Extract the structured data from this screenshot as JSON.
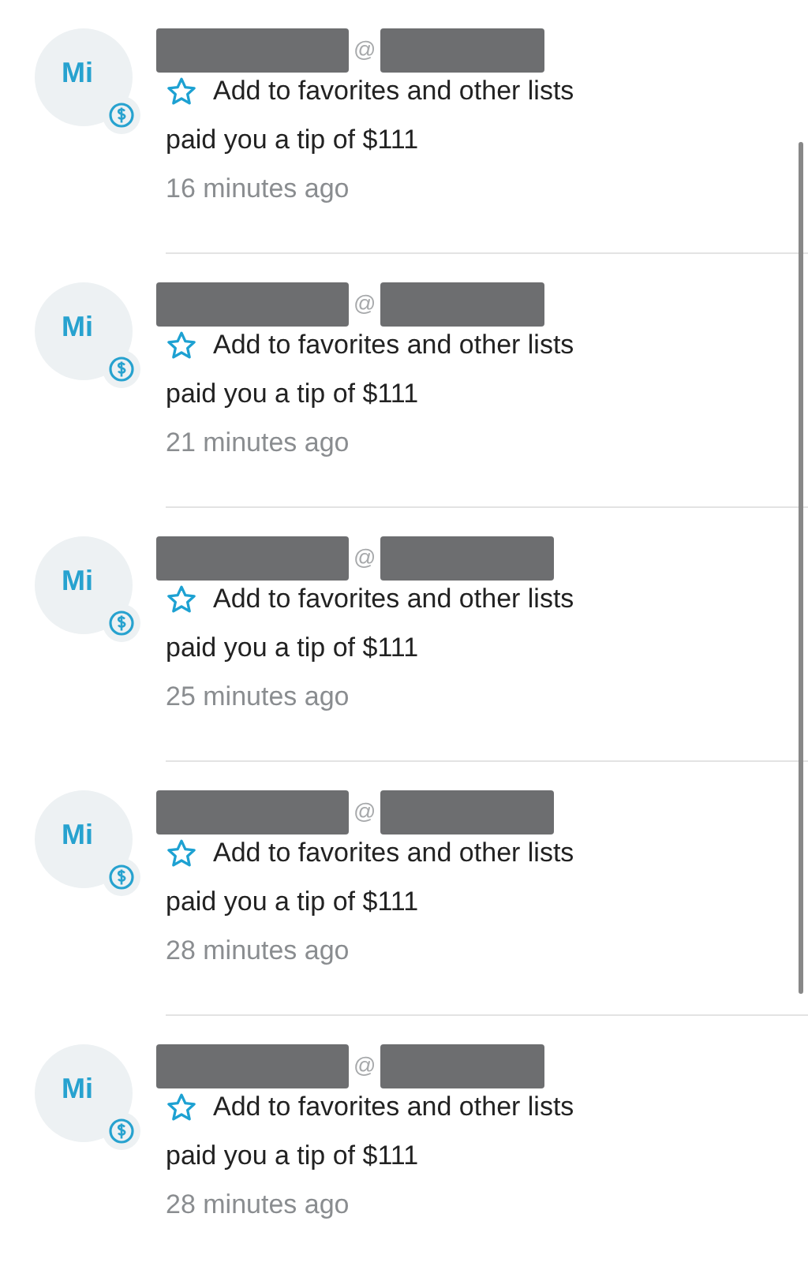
{
  "notifications": [
    {
      "avatar": "Mi",
      "at": "@",
      "favorite": {
        "label": "Add to favorites and other lists",
        "starred": false
      },
      "message": "paid you a tip of $111",
      "time": "16 minutes ago"
    },
    {
      "avatar": "Mi",
      "at": "@",
      "favorite": {
        "label": "Add to favorites and other lists",
        "starred": false
      },
      "message": "paid you a tip of $111",
      "time": "21 minutes ago"
    },
    {
      "avatar": "Mi",
      "at": "@",
      "favorite": {
        "label": "Add to favorites and other lists",
        "starred": false
      },
      "message": "paid you a tip of $111",
      "time": "25 minutes ago"
    },
    {
      "avatar": "Mi",
      "at": "@",
      "favorite": {
        "label": "Add to favorites and other lists",
        "starred": false
      },
      "message": "paid you a tip of $111",
      "time": "28 minutes ago"
    },
    {
      "avatar": "Mi",
      "at": "@",
      "favorite": {
        "label": "Add to favorites and other lists",
        "starred": false
      },
      "message": "paid you a tip of $111",
      "time": "28 minutes ago"
    }
  ]
}
